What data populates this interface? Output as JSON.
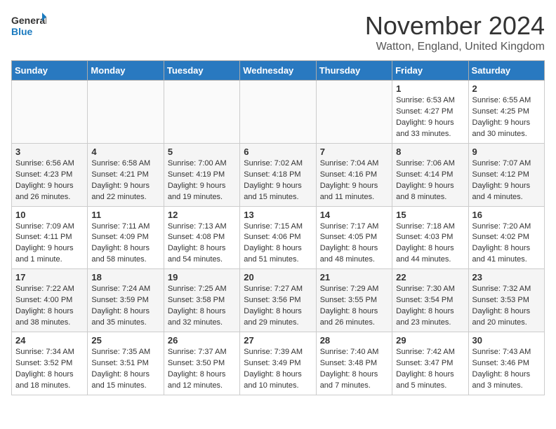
{
  "header": {
    "logo_general": "General",
    "logo_blue": "Blue",
    "month": "November 2024",
    "location": "Watton, England, United Kingdom"
  },
  "weekdays": [
    "Sunday",
    "Monday",
    "Tuesday",
    "Wednesday",
    "Thursday",
    "Friday",
    "Saturday"
  ],
  "weeks": [
    [
      {
        "day": "",
        "info": ""
      },
      {
        "day": "",
        "info": ""
      },
      {
        "day": "",
        "info": ""
      },
      {
        "day": "",
        "info": ""
      },
      {
        "day": "",
        "info": ""
      },
      {
        "day": "1",
        "info": "Sunrise: 6:53 AM\nSunset: 4:27 PM\nDaylight: 9 hours and 33 minutes."
      },
      {
        "day": "2",
        "info": "Sunrise: 6:55 AM\nSunset: 4:25 PM\nDaylight: 9 hours and 30 minutes."
      }
    ],
    [
      {
        "day": "3",
        "info": "Sunrise: 6:56 AM\nSunset: 4:23 PM\nDaylight: 9 hours and 26 minutes."
      },
      {
        "day": "4",
        "info": "Sunrise: 6:58 AM\nSunset: 4:21 PM\nDaylight: 9 hours and 22 minutes."
      },
      {
        "day": "5",
        "info": "Sunrise: 7:00 AM\nSunset: 4:19 PM\nDaylight: 9 hours and 19 minutes."
      },
      {
        "day": "6",
        "info": "Sunrise: 7:02 AM\nSunset: 4:18 PM\nDaylight: 9 hours and 15 minutes."
      },
      {
        "day": "7",
        "info": "Sunrise: 7:04 AM\nSunset: 4:16 PM\nDaylight: 9 hours and 11 minutes."
      },
      {
        "day": "8",
        "info": "Sunrise: 7:06 AM\nSunset: 4:14 PM\nDaylight: 9 hours and 8 minutes."
      },
      {
        "day": "9",
        "info": "Sunrise: 7:07 AM\nSunset: 4:12 PM\nDaylight: 9 hours and 4 minutes."
      }
    ],
    [
      {
        "day": "10",
        "info": "Sunrise: 7:09 AM\nSunset: 4:11 PM\nDaylight: 9 hours and 1 minute."
      },
      {
        "day": "11",
        "info": "Sunrise: 7:11 AM\nSunset: 4:09 PM\nDaylight: 8 hours and 58 minutes."
      },
      {
        "day": "12",
        "info": "Sunrise: 7:13 AM\nSunset: 4:08 PM\nDaylight: 8 hours and 54 minutes."
      },
      {
        "day": "13",
        "info": "Sunrise: 7:15 AM\nSunset: 4:06 PM\nDaylight: 8 hours and 51 minutes."
      },
      {
        "day": "14",
        "info": "Sunrise: 7:17 AM\nSunset: 4:05 PM\nDaylight: 8 hours and 48 minutes."
      },
      {
        "day": "15",
        "info": "Sunrise: 7:18 AM\nSunset: 4:03 PM\nDaylight: 8 hours and 44 minutes."
      },
      {
        "day": "16",
        "info": "Sunrise: 7:20 AM\nSunset: 4:02 PM\nDaylight: 8 hours and 41 minutes."
      }
    ],
    [
      {
        "day": "17",
        "info": "Sunrise: 7:22 AM\nSunset: 4:00 PM\nDaylight: 8 hours and 38 minutes."
      },
      {
        "day": "18",
        "info": "Sunrise: 7:24 AM\nSunset: 3:59 PM\nDaylight: 8 hours and 35 minutes."
      },
      {
        "day": "19",
        "info": "Sunrise: 7:25 AM\nSunset: 3:58 PM\nDaylight: 8 hours and 32 minutes."
      },
      {
        "day": "20",
        "info": "Sunrise: 7:27 AM\nSunset: 3:56 PM\nDaylight: 8 hours and 29 minutes."
      },
      {
        "day": "21",
        "info": "Sunrise: 7:29 AM\nSunset: 3:55 PM\nDaylight: 8 hours and 26 minutes."
      },
      {
        "day": "22",
        "info": "Sunrise: 7:30 AM\nSunset: 3:54 PM\nDaylight: 8 hours and 23 minutes."
      },
      {
        "day": "23",
        "info": "Sunrise: 7:32 AM\nSunset: 3:53 PM\nDaylight: 8 hours and 20 minutes."
      }
    ],
    [
      {
        "day": "24",
        "info": "Sunrise: 7:34 AM\nSunset: 3:52 PM\nDaylight: 8 hours and 18 minutes."
      },
      {
        "day": "25",
        "info": "Sunrise: 7:35 AM\nSunset: 3:51 PM\nDaylight: 8 hours and 15 minutes."
      },
      {
        "day": "26",
        "info": "Sunrise: 7:37 AM\nSunset: 3:50 PM\nDaylight: 8 hours and 12 minutes."
      },
      {
        "day": "27",
        "info": "Sunrise: 7:39 AM\nSunset: 3:49 PM\nDaylight: 8 hours and 10 minutes."
      },
      {
        "day": "28",
        "info": "Sunrise: 7:40 AM\nSunset: 3:48 PM\nDaylight: 8 hours and 7 minutes."
      },
      {
        "day": "29",
        "info": "Sunrise: 7:42 AM\nSunset: 3:47 PM\nDaylight: 8 hours and 5 minutes."
      },
      {
        "day": "30",
        "info": "Sunrise: 7:43 AM\nSunset: 3:46 PM\nDaylight: 8 hours and 3 minutes."
      }
    ]
  ]
}
